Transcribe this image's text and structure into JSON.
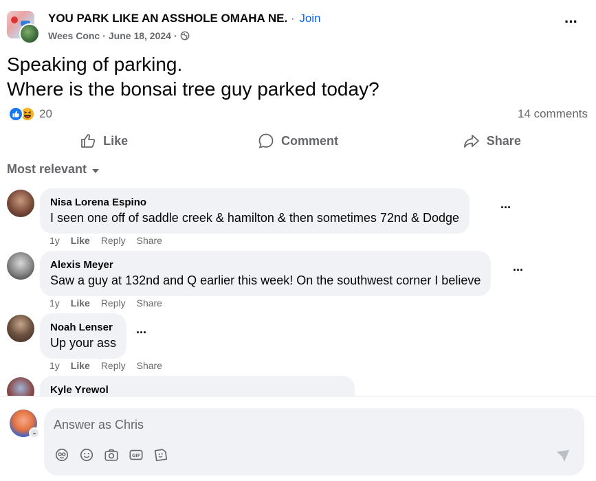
{
  "post": {
    "group_name": "YOU PARK LIKE AN ASSHOLE OMAHA NE.",
    "join_label": "Join",
    "author": "Wees Conc",
    "date": "June 18, 2024",
    "text_line1": "Speaking of parking.",
    "text_line2": "Where is the bonsai tree guy parked today?",
    "reaction_count": "20",
    "comments_count": "14 comments"
  },
  "actions": {
    "like": "Like",
    "comment": "Comment",
    "share": "Share"
  },
  "sort_label": "Most relevant",
  "comments": [
    {
      "name": "Nisa Lorena Espino",
      "text": "I seen one off of saddle creek & hamilton & then sometimes 72nd & Dodge",
      "age": "1y",
      "like": "Like",
      "reply": "Reply",
      "share": "Share"
    },
    {
      "name": "Alexis Meyer",
      "text": "Saw a guy at 132nd and Q earlier this week! On the southwest corner I believe",
      "age": "1y",
      "like": "Like",
      "reply": "Reply",
      "share": "Share"
    },
    {
      "name": "Noah Lenser",
      "text": "Up your ass",
      "age": "1y",
      "like": "Like",
      "reply": "Reply",
      "share": "Share"
    },
    {
      "name": "Kyle Yrewol",
      "text": ""
    }
  ],
  "composer": {
    "placeholder": "Answer as Chris"
  },
  "colors": {
    "accent": "#0866ff",
    "secondary_text": "#65676b",
    "bubble_bg": "#f0f2f5"
  },
  "icons": {
    "more": "more-horizontal-icon",
    "globe": "globe-icon",
    "like": "thumbs-up-icon",
    "comment": "comment-bubble-icon",
    "share": "share-arrow-icon",
    "send": "send-icon",
    "tools": [
      "avatar-sticker-icon",
      "emoji-icon",
      "camera-icon",
      "gif-icon",
      "sticker-icon"
    ]
  }
}
